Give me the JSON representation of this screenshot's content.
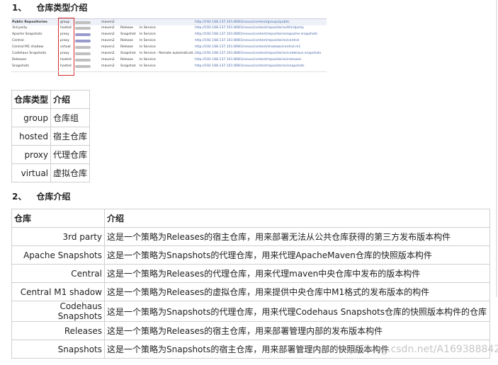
{
  "section1": {
    "num": "1、",
    "title": "仓库类型介绍"
  },
  "screenshot": {
    "rows": [
      {
        "name": "Public Repositories",
        "type": "group",
        "format": "maven2",
        "policy": "",
        "status": "",
        "url": "http://192.168.137.101:8081/nexus/content/groups/public"
      },
      {
        "name": "3rd party",
        "type": "hosted",
        "format": "maven2",
        "policy": "Release",
        "status": "In Service",
        "url": "http://192.168.137.101:8081/nexus/content/repositories/thirdparty"
      },
      {
        "name": "Apache Snapshots",
        "type": "proxy",
        "format": "maven2",
        "policy": "Snapshot",
        "status": "In Service",
        "url": "http://192.168.137.101:8081/nexus/content/repositories/apache-snapshots"
      },
      {
        "name": "Central",
        "type": "proxy",
        "format": "maven2",
        "policy": "Release",
        "status": "In Service",
        "url": "http://192.168.137.101:8081/nexus/content/repositories/central"
      },
      {
        "name": "Central M1 shadow",
        "type": "virtual",
        "format": "maven1",
        "policy": "Release",
        "status": "In Service",
        "url": "http://192.168.137.101:8081/nexus/content/shadows/central-m1"
      },
      {
        "name": "Codehaus Snapshots",
        "type": "proxy",
        "format": "maven2",
        "policy": "Snapshot",
        "status": "In Service - Remote automaticall...",
        "url": "http://192.168.137.101:8081/nexus/content/repositories/codehaus-snapshots"
      },
      {
        "name": "Releases",
        "type": "hosted",
        "format": "maven2",
        "policy": "Release",
        "status": "In Service",
        "url": "http://192.168.137.101:8081/nexus/content/repositories/releases"
      },
      {
        "name": "Snapshots",
        "type": "hosted",
        "format": "maven2",
        "policy": "Snapshot",
        "status": "In Service",
        "url": "http://192.168.137.101:8081/nexus/content/repositories/snapshots"
      }
    ]
  },
  "table1": {
    "headers": [
      "仓库类型",
      "介绍"
    ],
    "rows": [
      [
        "group",
        "仓库组"
      ],
      [
        "hosted",
        "宿主仓库"
      ],
      [
        "proxy",
        "代理仓库"
      ],
      [
        "virtual",
        "虚拟仓库"
      ]
    ]
  },
  "section2": {
    "num": "2、",
    "title": "仓库介绍"
  },
  "table2": {
    "headers": [
      "仓库",
      "介绍"
    ],
    "rows": [
      [
        "3rd party",
        "这是一个策略为Releases的宿主仓库，用来部署无法从公共仓库获得的第三方发布版本构件"
      ],
      [
        "Apache Snapshots",
        "这是一个策略为Snapshots的代理仓库，用来代理ApacheMaven仓库的快照版本构件"
      ],
      [
        "Central",
        "这是一个策略为Releases的代理仓库，用来代理maven中央仓库中发布的版本构件"
      ],
      [
        "Central M1 shadow",
        "这是一个策略为Releases的虚拟仓库，用来提供中央仓库中M1格式的发布版本的构件"
      ],
      [
        "Codehaus Snapshots",
        "这是一个策略为Snapshots的代理仓库，用来代理Codehaus Snapshots仓库的快照版本构件的仓库"
      ],
      [
        "Releases",
        "这是一个策略为Releases的宿主仓库，用来部署管理内部的发布版本构件"
      ],
      [
        "Snapshots",
        "这是一个策略为Snapshots的宿主仓库，用来部署管理内部的快照版本构件"
      ]
    ]
  },
  "watermark": "http://blog.csdn.net/A169388842"
}
